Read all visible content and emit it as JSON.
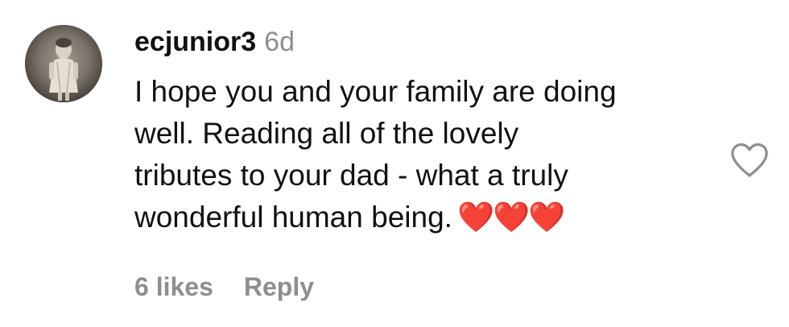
{
  "comment": {
    "username": "ecjunior3",
    "time_ago": "6d",
    "text_lines": [
      "I hope you and your family are doing",
      "well. Reading all of the lovely",
      "tributes to your dad - what a truly",
      "wonderful human being."
    ],
    "emoji": "❤️❤️❤️",
    "likes_label": "6 likes",
    "reply_label": "Reply",
    "avatar_icon": "vintage-child-photo",
    "like_icon": "heart-outline-icon",
    "colors": {
      "text": "#111111",
      "muted": "#8e8e8e",
      "heart": "#e0242c"
    }
  }
}
